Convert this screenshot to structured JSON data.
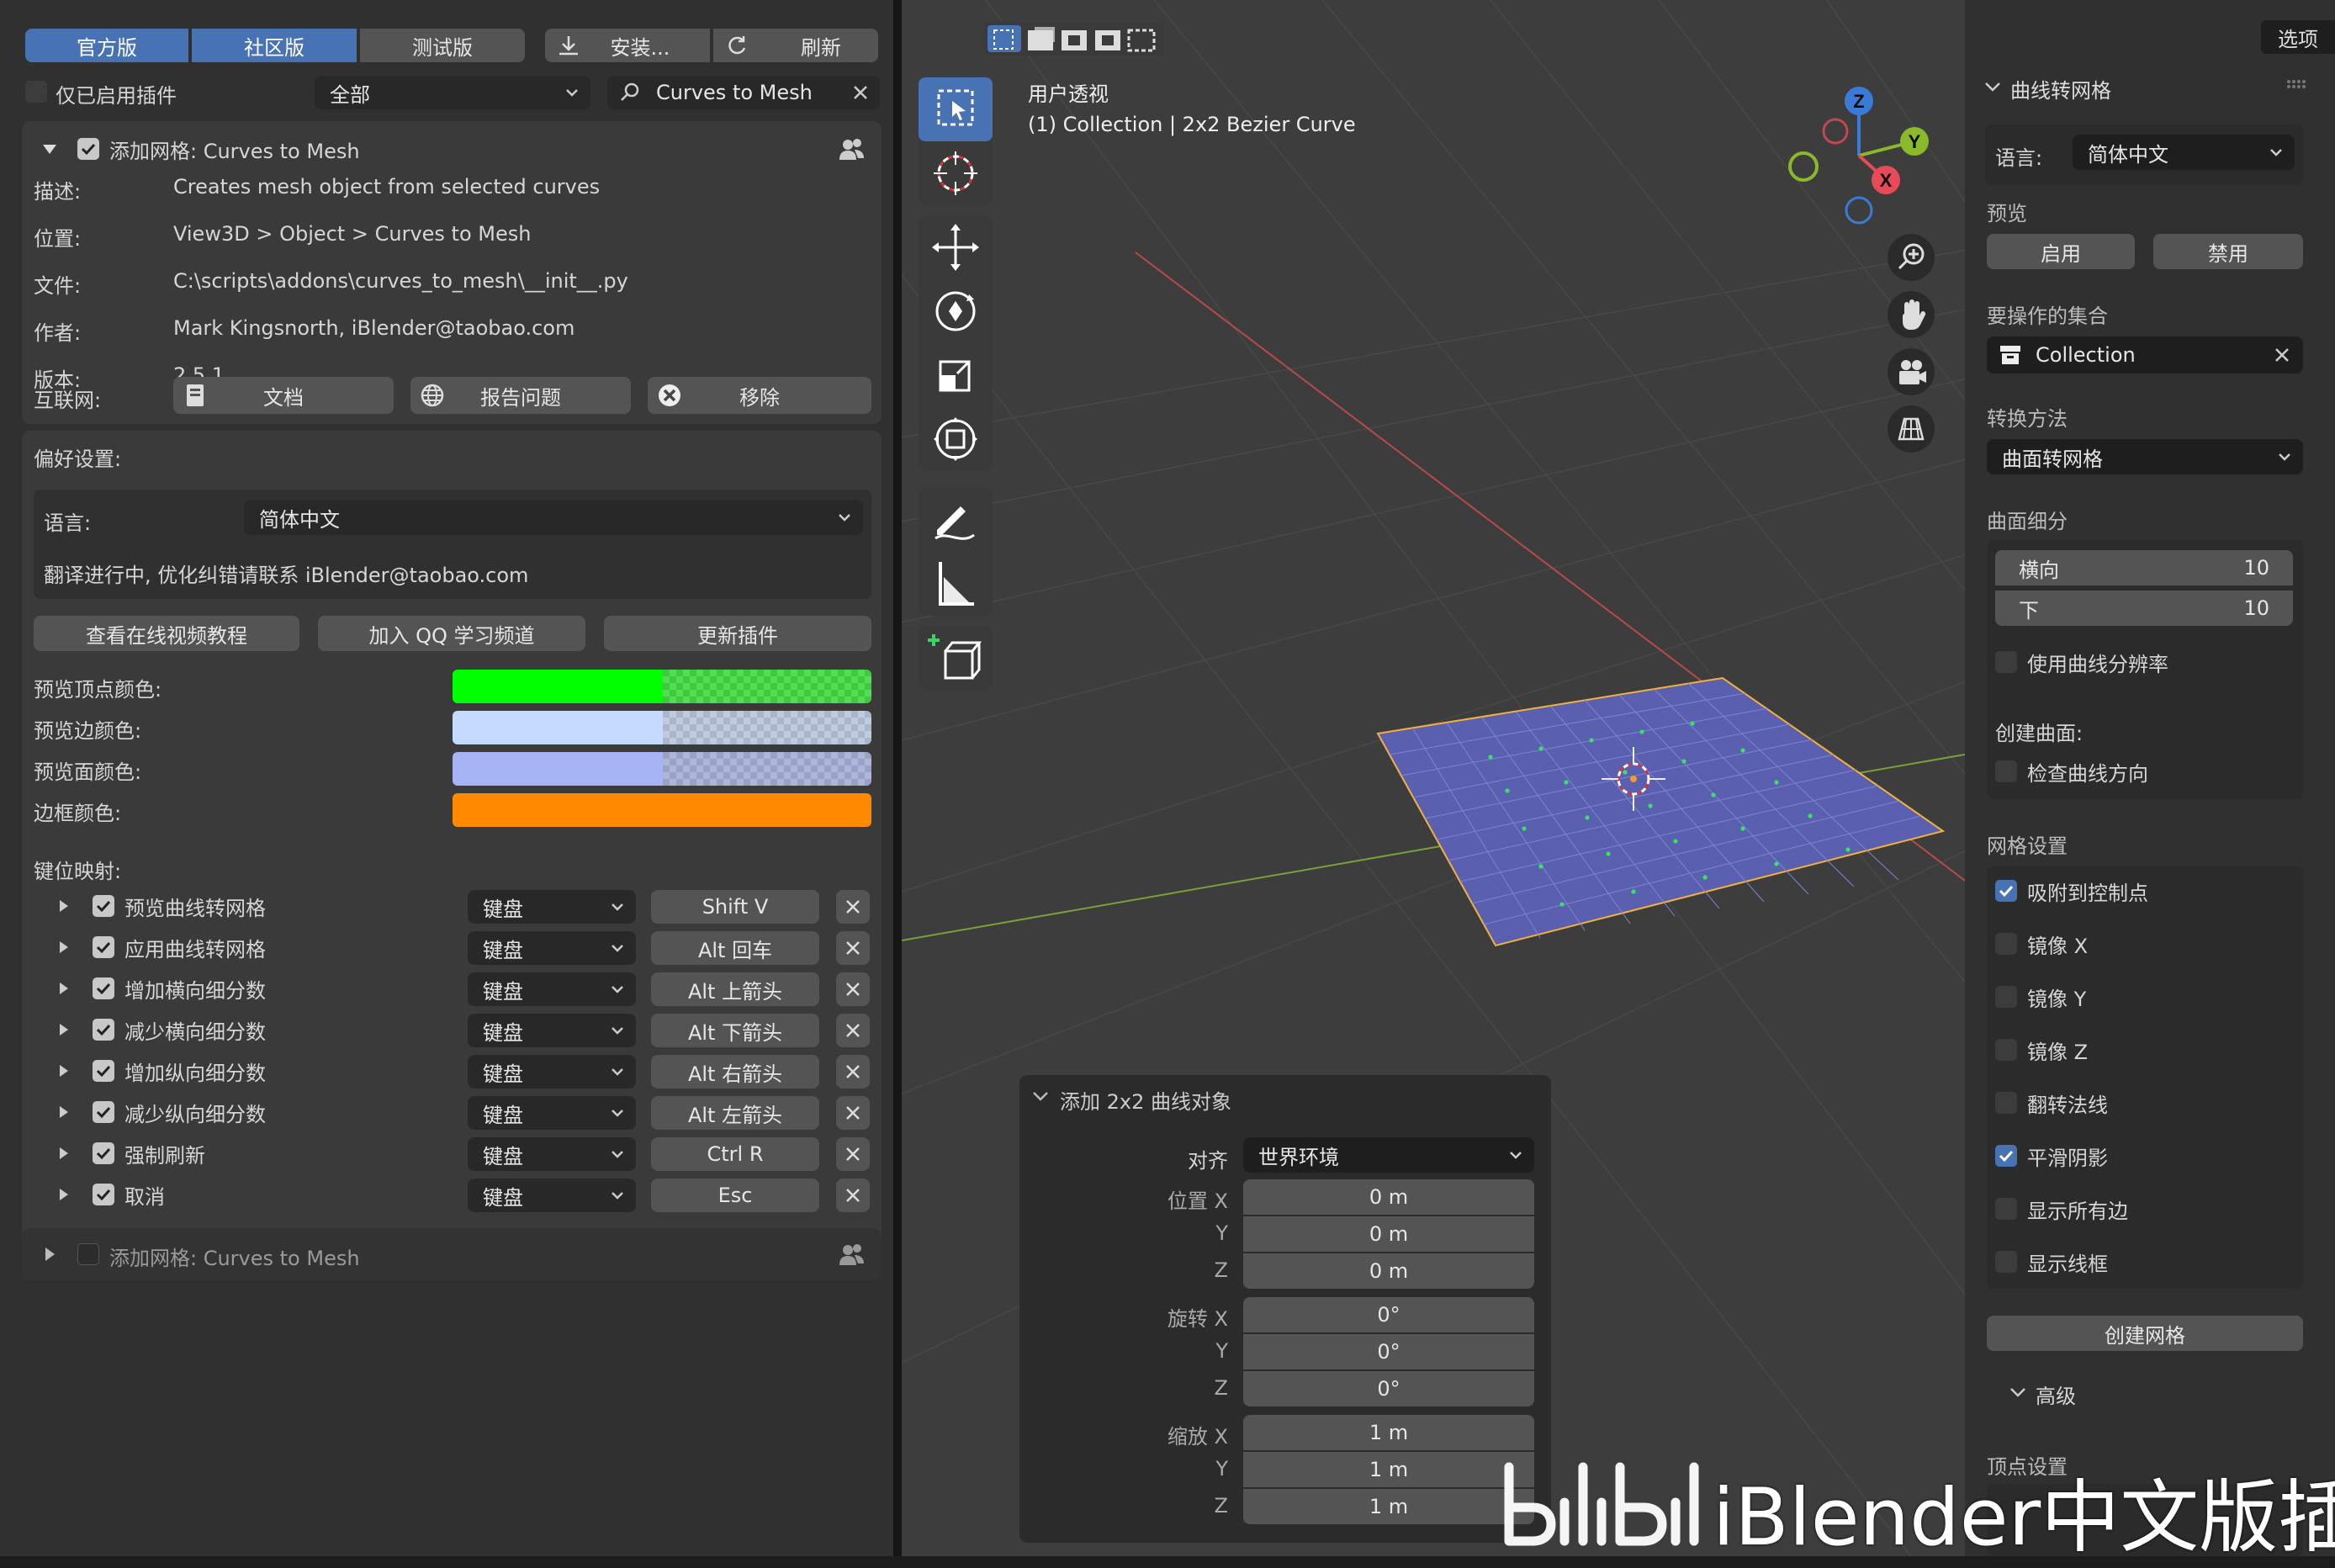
{
  "addons": {
    "tabs": [
      "官方版",
      "社区版",
      "测试版"
    ],
    "active_tabs": [
      0,
      1
    ],
    "install_label": "安装...",
    "refresh_label": "刷新",
    "enabled_only_label": "仅已启用插件",
    "category_value": "全部",
    "search_value": "Curves to Mesh",
    "addon": {
      "title": "添加网格: Curves to Mesh",
      "fields": [
        {
          "label": "描述:",
          "value": "Creates mesh object from selected curves"
        },
        {
          "label": "位置:",
          "value": "View3D > Object > Curves to Mesh"
        },
        {
          "label": "文件:",
          "value": "C:\\scripts\\addons\\curves_to_mesh\\__init__.py"
        },
        {
          "label": "作者:",
          "value": "Mark Kingsnorth, iBlender@taobao.com"
        },
        {
          "label": "版本:",
          "value": "2.5.1"
        }
      ],
      "internet_label": "互联网:",
      "doc_label": "文档",
      "report_label": "报告问题",
      "remove_label": "移除"
    },
    "prefs": {
      "title": "偏好设置:",
      "language_label": "语言:",
      "language_value": "简体中文",
      "note": "翻译进行中, 优化纠错请联系 iBlender@taobao.com",
      "buttons": [
        "查看在线视频教程",
        "加入 QQ 学习频道",
        "更新插件"
      ],
      "colors": [
        {
          "label": "预览顶点颜色:",
          "color": "#00ff00"
        },
        {
          "label": "预览边颜色:",
          "color": "#c4daff"
        },
        {
          "label": "预览面颜色:",
          "color": "#a6b4f5"
        },
        {
          "label": "边框颜色:",
          "color": "#ff8a00"
        }
      ],
      "keymap_label": "键位映射:",
      "keymap": [
        {
          "name": "预览曲线转网格",
          "device": "键盘",
          "key": "Shift V"
        },
        {
          "name": "应用曲线转网格",
          "device": "键盘",
          "key": "Alt 回车"
        },
        {
          "name": "增加横向细分数",
          "device": "键盘",
          "key": "Alt 上箭头"
        },
        {
          "name": "减少横向细分数",
          "device": "键盘",
          "key": "Alt 下箭头"
        },
        {
          "name": "增加纵向细分数",
          "device": "键盘",
          "key": "Alt 右箭头"
        },
        {
          "name": "减少纵向细分数",
          "device": "键盘",
          "key": "Alt 左箭头"
        },
        {
          "name": "强制刷新",
          "device": "键盘",
          "key": "Ctrl R"
        },
        {
          "name": "取消",
          "device": "键盘",
          "key": "Esc"
        }
      ]
    },
    "collapsed_addon_title": "添加网格: Curves to Mesh"
  },
  "viewport": {
    "view_name": "用户透视",
    "view_info": "(1) Collection | 2x2 Bezier Curve",
    "gizmo_axes": [
      "Z",
      "Y",
      "X"
    ],
    "operator_panel": {
      "title": "添加 2x2 曲线对象",
      "align_label": "对齐",
      "align_value": "世界环境",
      "rows": [
        {
          "label": "位置 X",
          "value": "0 m"
        },
        {
          "label": "Y",
          "value": "0 m"
        },
        {
          "label": "Z",
          "value": "0 m"
        },
        {
          "label": "旋转 X",
          "value": "0°"
        },
        {
          "label": "Y",
          "value": "0°"
        },
        {
          "label": "Z",
          "value": "0°"
        },
        {
          "label": "缩放 X",
          "value": "1 m"
        },
        {
          "label": "Y",
          "value": "1 m"
        },
        {
          "label": "Z",
          "value": "1 m"
        }
      ]
    }
  },
  "sidebar": {
    "options_label": "选项",
    "panel_title": "曲线转网格",
    "language_label": "语言:",
    "language_value": "简体中文",
    "preview_label": "预览",
    "enable_label": "启用",
    "disable_label": "禁用",
    "collection_label": "要操作的集合",
    "collection_value": "Collection",
    "method_label": "转换方法",
    "method_value": "曲面转网格",
    "subdiv_label": "曲面细分",
    "horizontal_label": "横向",
    "horizontal_value": "10",
    "vertical_label": "下",
    "vertical_value": "10",
    "use_curve_res_label": "使用曲线分辨率",
    "create_surface_label": "创建曲面:",
    "check_dir_label": "检查曲线方向",
    "mesh_settings_label": "网格设置",
    "mesh_options": [
      {
        "label": "吸附到控制点",
        "checked": true
      },
      {
        "label": "镜像 X",
        "checked": false
      },
      {
        "label": "镜像 Y",
        "checked": false
      },
      {
        "label": "镜像 Z",
        "checked": false
      },
      {
        "label": "翻转法线",
        "checked": false
      },
      {
        "label": "平滑阴影",
        "checked": true
      },
      {
        "label": "显示所有边",
        "checked": false
      },
      {
        "label": "显示线框",
        "checked": false
      }
    ],
    "create_mesh_label": "创建网格",
    "advanced_label": "高级",
    "vertex_settings_label": "顶点设置"
  },
  "watermark": {
    "text": "iBlender中文版插件"
  }
}
